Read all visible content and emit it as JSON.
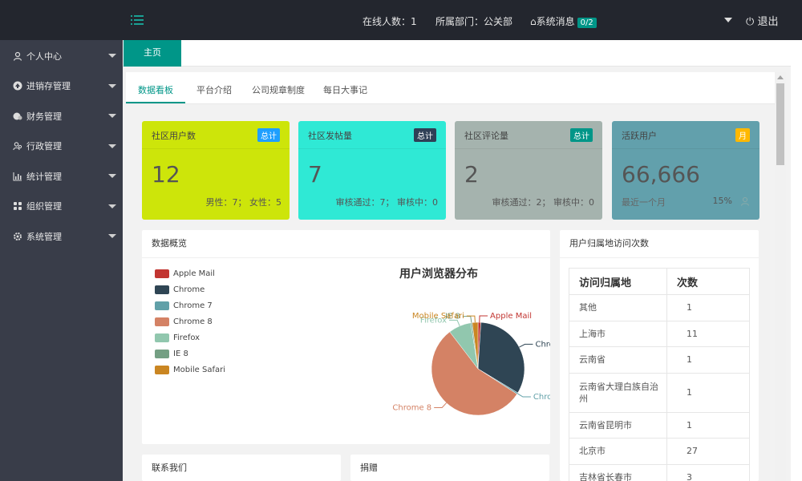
{
  "header": {
    "online": "在线人数：1",
    "department": "所属部门：公关部",
    "messages_label": "系统消息",
    "messages_badge": "0/2",
    "logout": "退出"
  },
  "sidebar": {
    "items": [
      {
        "label": "个人中心",
        "icon": "user-icon"
      },
      {
        "label": "进销存管理",
        "icon": "upload-icon"
      },
      {
        "label": "财务管理",
        "icon": "money-icon"
      },
      {
        "label": "行政管理",
        "icon": "users-icon"
      },
      {
        "label": "统计管理",
        "icon": "chart-icon"
      },
      {
        "label": "组织管理",
        "icon": "app-icon"
      },
      {
        "label": "系统管理",
        "icon": "gear-icon"
      }
    ]
  },
  "tabs": {
    "home": "主页"
  },
  "subtabs": [
    "数据看板",
    "平台介绍",
    "公司规章制度",
    "每日大事记"
  ],
  "stats": [
    {
      "title": "社区用户数",
      "badge": "总计",
      "value": "12",
      "foot": "男性：7； 女性：5",
      "bg": "#cde50a",
      "badge_bg": "#1e9fff"
    },
    {
      "title": "社区发帖量",
      "badge": "总计",
      "value": "7",
      "foot": "审核通过：7； 审核中：0",
      "bg": "#2fe9d5",
      "badge_bg": "#2f4056"
    },
    {
      "title": "社区评论量",
      "badge": "总计",
      "value": "2",
      "foot": "审核通过：2； 审核中：0",
      "bg": "#a5b3ae",
      "badge_bg": "#009688"
    },
    {
      "title": "活跃用户",
      "badge": "月",
      "value": "66,666",
      "foot_left": "最近一个月",
      "foot": "15%",
      "bg": "#62a0ac",
      "badge_bg": "#ffb800"
    }
  ],
  "overview": {
    "title": "数据概览",
    "chart_title": "用户浏览器分布"
  },
  "chart_data": {
    "type": "pie",
    "title": "用户浏览器分布",
    "legend_position": "left",
    "series": [
      {
        "name": "Apple Mail",
        "value": 1,
        "color": "#c23531"
      },
      {
        "name": "Chrome",
        "value": 33,
        "color": "#2f4554"
      },
      {
        "name": "Chrome 7",
        "value": 0.5,
        "color": "#61a0a8"
      },
      {
        "name": "Chrome 8",
        "value": 56,
        "color": "#d48265"
      },
      {
        "name": "Firefox",
        "value": 8,
        "color": "#91c7ae"
      },
      {
        "name": "IE 8",
        "value": 0.5,
        "color": "#749f83"
      },
      {
        "name": "Mobile Safari",
        "value": 2,
        "color": "#ca8622"
      }
    ]
  },
  "visits": {
    "title": "用户归属地访问次数",
    "headers": [
      "访问归属地",
      "次数"
    ],
    "rows": [
      [
        "其他",
        "1"
      ],
      [
        "上海市",
        "11"
      ],
      [
        "云南省",
        "1"
      ],
      [
        "云南省大理白族自治州",
        "1"
      ],
      [
        "云南省昆明市",
        "1"
      ],
      [
        "北京市",
        "27"
      ],
      [
        "吉林省长春市",
        "3"
      ]
    ]
  },
  "bottom_panels": {
    "contact": "联系我们",
    "donate": "捐赠"
  }
}
